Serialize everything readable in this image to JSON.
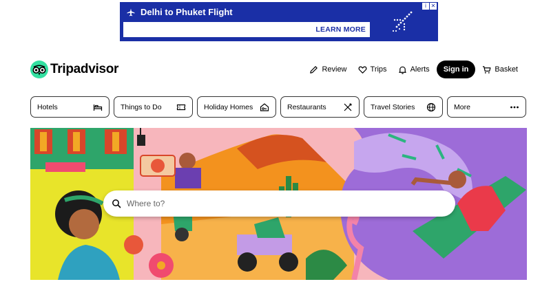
{
  "ad": {
    "title": "Delhi to Phuket Flight",
    "cta": "LEARN MORE",
    "badge_info": "i",
    "badge_close": "✕"
  },
  "header": {
    "logo_text": "Tripadvisor",
    "nav": {
      "review": "Review",
      "trips": "Trips",
      "alerts": "Alerts",
      "signin": "Sign in",
      "basket": "Basket"
    }
  },
  "tabs": [
    {
      "label": "Hotels",
      "icon": "bed-icon"
    },
    {
      "label": "Things to Do",
      "icon": "ticket-icon"
    },
    {
      "label": "Holiday Homes",
      "icon": "house-key-icon"
    },
    {
      "label": "Restaurants",
      "icon": "cutlery-icon"
    },
    {
      "label": "Travel Stories",
      "icon": "globe-icon"
    },
    {
      "label": "More",
      "icon": "more-dots-icon"
    }
  ],
  "search": {
    "placeholder": "Where to?"
  },
  "colors": {
    "ad_bg": "#1a2fa6",
    "brand_green": "#34e0a1",
    "signin_bg": "#000000"
  }
}
